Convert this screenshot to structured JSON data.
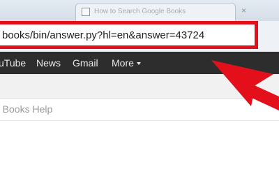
{
  "browser": {
    "tab_title": "How to Search Google Books",
    "tab_close_symbol": "×",
    "address_bar": {
      "url": "books/bin/answer.py?hl=en&answer=43724"
    }
  },
  "google_bar": {
    "items": [
      "uTube",
      "News",
      "Gmail",
      "More"
    ]
  },
  "page": {
    "help_title": "h Books Help"
  },
  "annotation": {
    "arrow_color": "#e3101b",
    "highlight_color": "#e3101b"
  }
}
